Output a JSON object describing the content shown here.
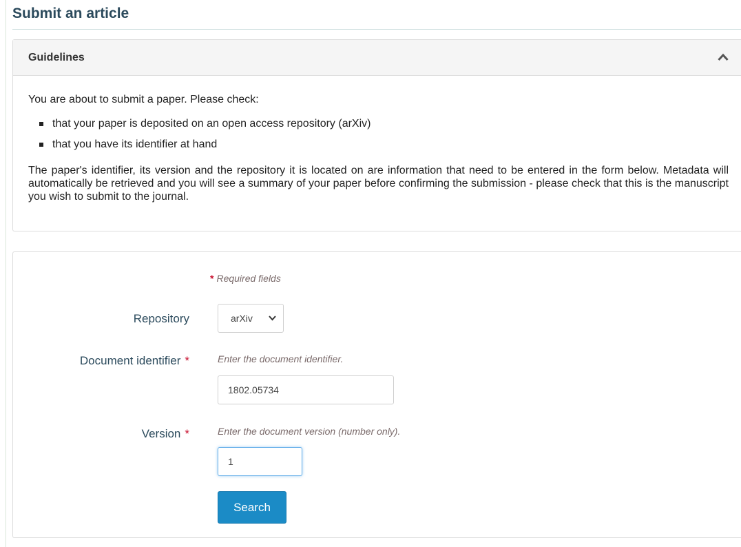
{
  "page": {
    "title": "Submit an article"
  },
  "guidelines": {
    "header": "Guidelines",
    "collapse_icon": "chevron-up-icon",
    "intro": "You are about to submit a paper. Please check:",
    "checklist": [
      "that your paper is deposited on an open access repository (arXiv)",
      "that you have its identifier at hand"
    ],
    "explanation": "The paper's identifier, its version and the repository it is located on are information that need to be entered in the form below. Metadata will automatically be retrieved and you will see a summary of your paper before confirming the submission - please check that this is the manuscript you wish to submit to the journal."
  },
  "form": {
    "required_star": "*",
    "required_note": "Required fields",
    "repository": {
      "label": "Repository",
      "selected": "arXiv",
      "chevron_icon": "chevron-down-icon"
    },
    "document_identifier": {
      "label": "Document identifier",
      "required_mark": "*",
      "help": "Enter the document identifier.",
      "value": "1802.05734"
    },
    "version": {
      "label": "Version",
      "required_mark": "*",
      "help": "Enter the document version (number only).",
      "value": "1"
    },
    "search_label": "Search"
  },
  "colors": {
    "title": "#2b4a5c",
    "required": "#c8102e",
    "button": "#1b8bc6",
    "focus_border": "#66afe9"
  }
}
